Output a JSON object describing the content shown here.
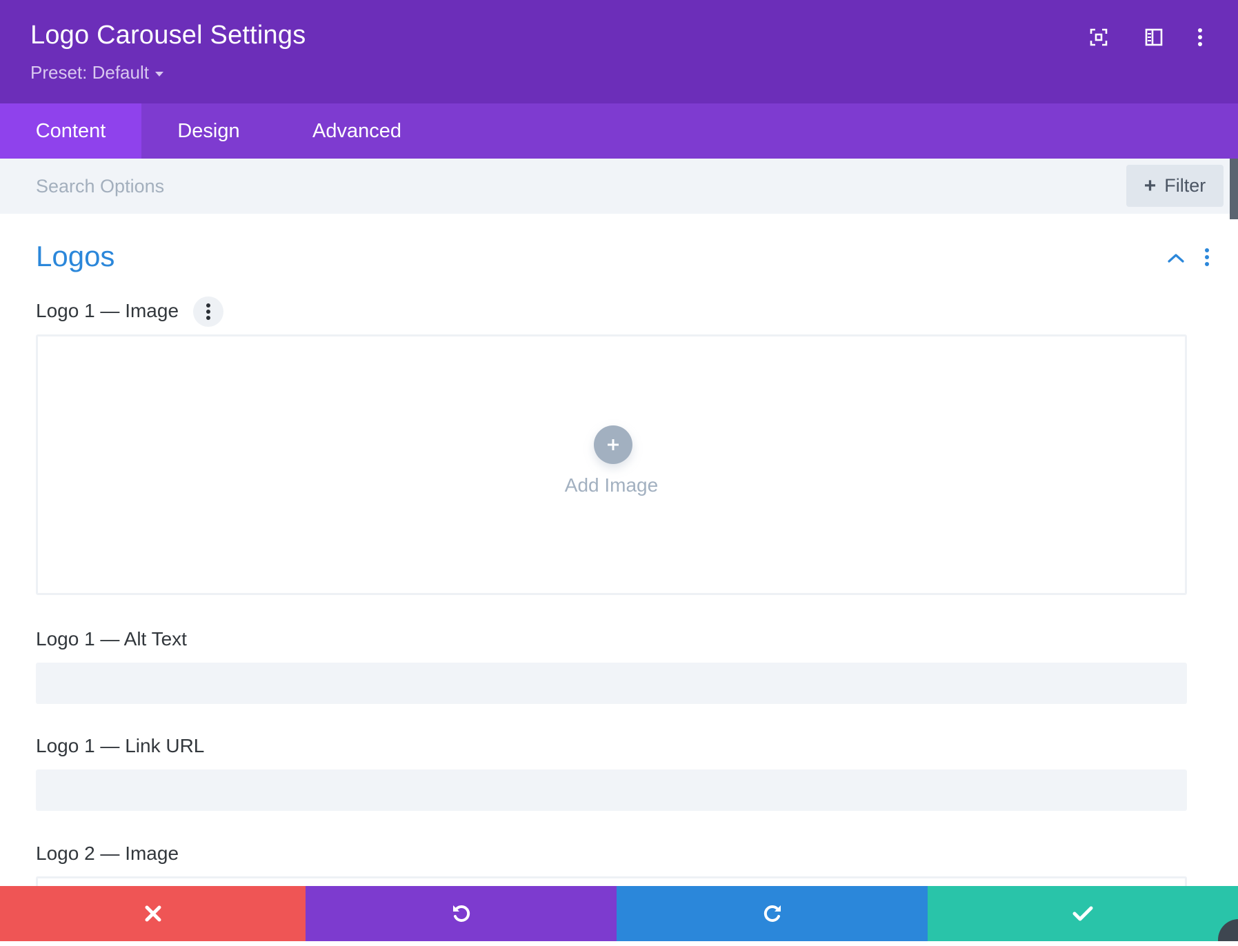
{
  "header": {
    "title": "Logo Carousel Settings",
    "preset_label": "Preset: Default",
    "icons": [
      "fullscreen-icon",
      "sidebar-layout-icon",
      "more-vertical-icon"
    ]
  },
  "tabs": [
    {
      "label": "Content",
      "active": true
    },
    {
      "label": "Design",
      "active": false
    },
    {
      "label": "Advanced",
      "active": false
    }
  ],
  "search": {
    "placeholder": "Search Options",
    "value": "",
    "filter_label": "Filter"
  },
  "section": {
    "title": "Logos",
    "expanded": true
  },
  "fields": {
    "logo1_image_label": "Logo 1 — Image",
    "add_image_label": "Add Image",
    "logo1_alt_label": "Logo 1 — Alt Text",
    "logo1_alt_value": "",
    "logo1_link_label": "Logo 1 — Link URL",
    "logo1_link_value": "",
    "logo2_image_label": "Logo 2 — Image"
  },
  "footer": {
    "buttons": [
      "discard-icon",
      "undo-icon",
      "redo-icon",
      "save-icon"
    ]
  },
  "colors": {
    "header": "#6c2eb9",
    "tabs": "#7e3bd0",
    "active_tab": "#8f42ec",
    "section_title": "#2b87da",
    "discard": "#ef5555",
    "undo": "#7d3bcf",
    "redo": "#2b87da",
    "save": "#29c4a9"
  }
}
